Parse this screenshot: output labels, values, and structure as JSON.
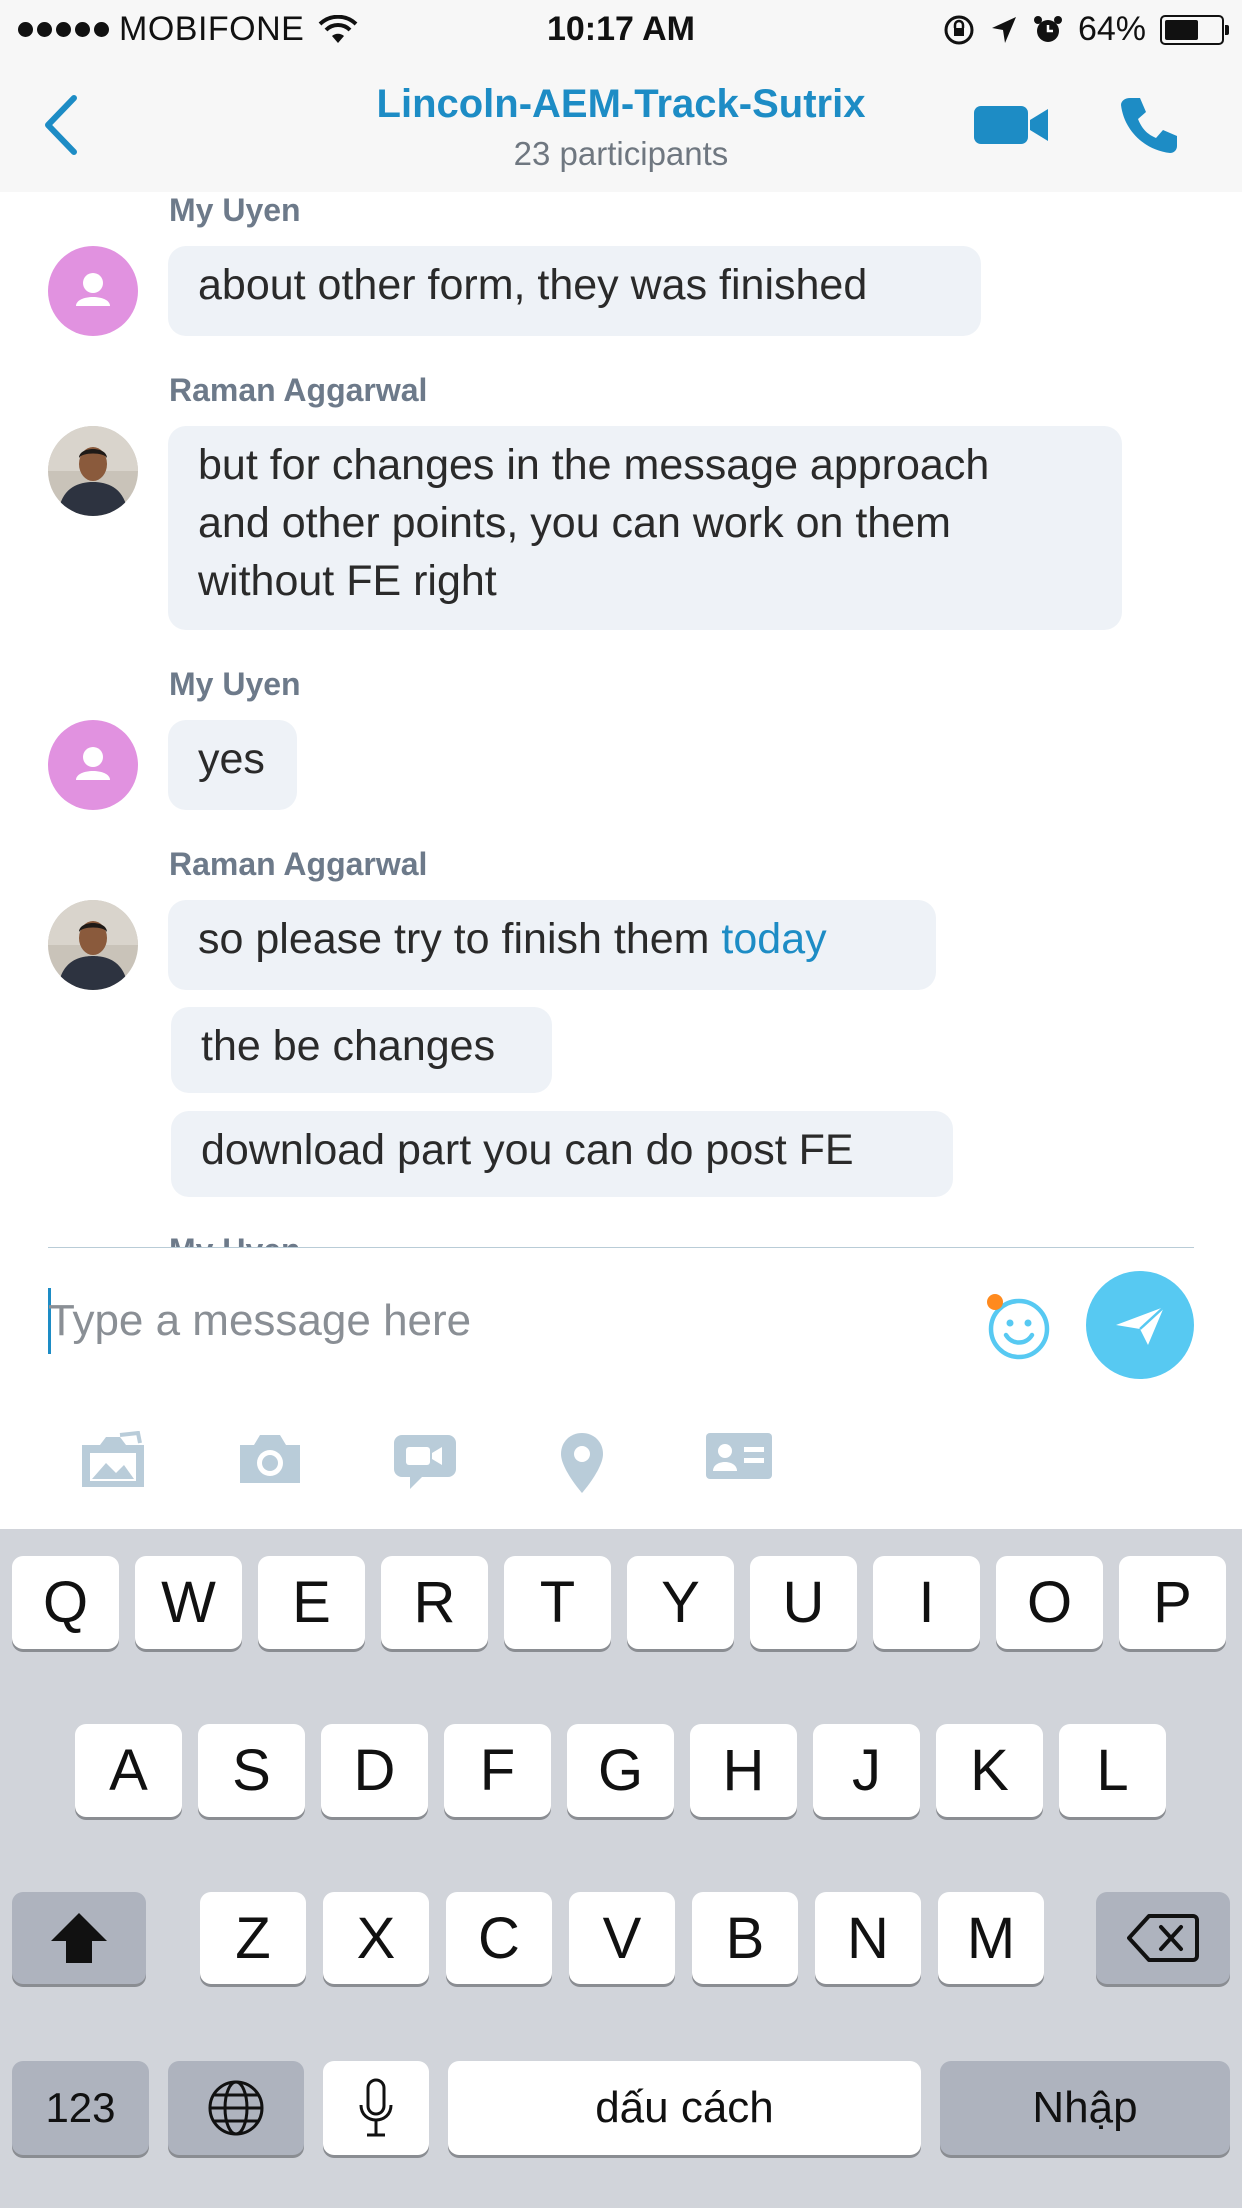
{
  "status": {
    "carrier": "MOBIFONE",
    "time": "10:17 AM",
    "battery": "64%",
    "battery_level": 0.64
  },
  "header": {
    "title": "Lincoln-AEM-Track-Sutrix",
    "subtitle": "23 participants"
  },
  "messages": [
    {
      "sender": "My Uyen",
      "bubbles": [
        {
          "text": "about other form, they was finished"
        }
      ]
    },
    {
      "sender": "Raman Aggarwal",
      "bubbles": [
        {
          "line1": "but for changes in the message approach",
          "line2": "and other points,  you can work on them",
          "line3": "without FE right"
        }
      ]
    },
    {
      "sender": "My Uyen",
      "bubbles": [
        {
          "text": "yes"
        }
      ]
    },
    {
      "sender": "Raman Aggarwal",
      "bubbles": [
        {
          "text": "so please try to finish them ",
          "link": "today"
        },
        {
          "text": "the be changes"
        },
        {
          "text": "download part you can do post FE"
        }
      ]
    }
  ],
  "composer": {
    "placeholder": "Type a message here"
  },
  "keyboard": {
    "row1": [
      "Q",
      "W",
      "E",
      "R",
      "T",
      "Y",
      "U",
      "I",
      "O",
      "P"
    ],
    "row2": [
      "A",
      "S",
      "D",
      "F",
      "G",
      "H",
      "J",
      "K",
      "L"
    ],
    "row3": [
      "Z",
      "X",
      "C",
      "V",
      "B",
      "N",
      "M"
    ],
    "numbers": "123",
    "space": "dấu cách",
    "return": "Nhập"
  },
  "colors": {
    "accent": "#1d8cc5",
    "send_button": "#57c9f2",
    "bubble": "#eef2f7",
    "default_avatar": "#e192e0"
  },
  "icons": {
    "back": "chevron-left-icon",
    "video": "video-camera-icon",
    "call": "phone-icon",
    "emoji": "smiley-icon",
    "send": "paper-plane-icon",
    "toolbar": [
      "photo-album-icon",
      "camera-icon",
      "video-message-icon",
      "location-pin-icon",
      "contact-card-icon"
    ]
  }
}
